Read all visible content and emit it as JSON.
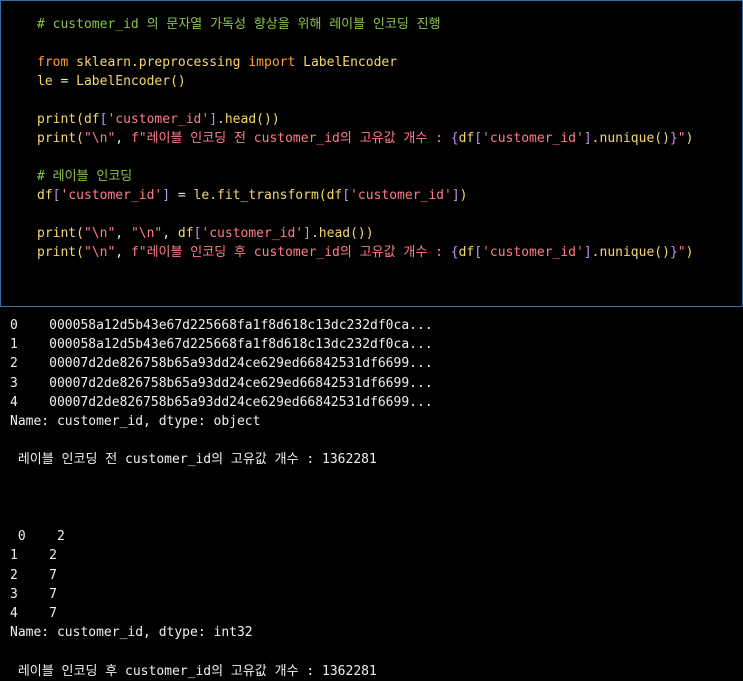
{
  "code_cell": {
    "lines": [
      {
        "tokens": [
          {
            "t": "# customer_id 의 문자열 가독성 향상을 위해 레이블 인코딩 진행",
            "c": "comment"
          }
        ]
      },
      {
        "tokens": []
      },
      {
        "tokens": [
          {
            "t": "from",
            "c": "keyword"
          },
          {
            "t": " ",
            "c": "punct"
          },
          {
            "t": "sklearn.preprocessing",
            "c": "module"
          },
          {
            "t": " ",
            "c": "punct"
          },
          {
            "t": "import",
            "c": "keyword"
          },
          {
            "t": " ",
            "c": "punct"
          },
          {
            "t": "LabelEncoder",
            "c": "class"
          }
        ]
      },
      {
        "tokens": [
          {
            "t": "le",
            "c": "var"
          },
          {
            "t": " = ",
            "c": "punct"
          },
          {
            "t": "LabelEncoder",
            "c": "class"
          },
          {
            "t": "()",
            "c": "bracket"
          }
        ]
      },
      {
        "tokens": []
      },
      {
        "tokens": [
          {
            "t": "print",
            "c": "func"
          },
          {
            "t": "(",
            "c": "bracket"
          },
          {
            "t": "df",
            "c": "var"
          },
          {
            "t": "[",
            "c": "brace"
          },
          {
            "t": "'customer_id'",
            "c": "string"
          },
          {
            "t": "]",
            "c": "brace"
          },
          {
            "t": ".head",
            "c": "func"
          },
          {
            "t": "())",
            "c": "bracket"
          }
        ]
      },
      {
        "tokens": [
          {
            "t": "print",
            "c": "func"
          },
          {
            "t": "(",
            "c": "bracket"
          },
          {
            "t": "\"\\n\"",
            "c": "string"
          },
          {
            "t": ", ",
            "c": "punct"
          },
          {
            "t": "f",
            "c": "fprefix"
          },
          {
            "t": "\"레이블 인코딩 전 customer_id의 고유값 개수 : ",
            "c": "string"
          },
          {
            "t": "{",
            "c": "brace"
          },
          {
            "t": "df",
            "c": "var"
          },
          {
            "t": "[",
            "c": "brace"
          },
          {
            "t": "'customer_id'",
            "c": "string"
          },
          {
            "t": "]",
            "c": "brace"
          },
          {
            "t": ".nunique",
            "c": "func"
          },
          {
            "t": "()",
            "c": "bracket"
          },
          {
            "t": "}",
            "c": "brace"
          },
          {
            "t": "\"",
            "c": "string"
          },
          {
            "t": ")",
            "c": "bracket"
          }
        ]
      },
      {
        "tokens": []
      },
      {
        "tokens": [
          {
            "t": "# 레이블 인코딩",
            "c": "comment"
          }
        ]
      },
      {
        "tokens": [
          {
            "t": "df",
            "c": "var"
          },
          {
            "t": "[",
            "c": "brace"
          },
          {
            "t": "'customer_id'",
            "c": "string"
          },
          {
            "t": "]",
            "c": "brace"
          },
          {
            "t": " = ",
            "c": "punct"
          },
          {
            "t": "le",
            "c": "var"
          },
          {
            "t": ".fit_transform",
            "c": "func"
          },
          {
            "t": "(",
            "c": "bracket"
          },
          {
            "t": "df",
            "c": "var"
          },
          {
            "t": "[",
            "c": "brace"
          },
          {
            "t": "'customer_id'",
            "c": "string"
          },
          {
            "t": "]",
            "c": "brace"
          },
          {
            "t": ")",
            "c": "bracket"
          }
        ]
      },
      {
        "tokens": []
      },
      {
        "tokens": [
          {
            "t": "print",
            "c": "func"
          },
          {
            "t": "(",
            "c": "bracket"
          },
          {
            "t": "\"\\n\"",
            "c": "string"
          },
          {
            "t": ", ",
            "c": "punct"
          },
          {
            "t": "\"\\n\"",
            "c": "string"
          },
          {
            "t": ", ",
            "c": "punct"
          },
          {
            "t": "df",
            "c": "var"
          },
          {
            "t": "[",
            "c": "brace"
          },
          {
            "t": "'customer_id'",
            "c": "string"
          },
          {
            "t": "]",
            "c": "brace"
          },
          {
            "t": ".head",
            "c": "func"
          },
          {
            "t": "())",
            "c": "bracket"
          }
        ]
      },
      {
        "tokens": [
          {
            "t": "print",
            "c": "func"
          },
          {
            "t": "(",
            "c": "bracket"
          },
          {
            "t": "\"\\n\"",
            "c": "string"
          },
          {
            "t": ", ",
            "c": "punct"
          },
          {
            "t": "f",
            "c": "fprefix"
          },
          {
            "t": "\"레이블 인코딩 후 customer_id의 고유값 개수 : ",
            "c": "string"
          },
          {
            "t": "{",
            "c": "brace"
          },
          {
            "t": "df",
            "c": "var"
          },
          {
            "t": "[",
            "c": "brace"
          },
          {
            "t": "'customer_id'",
            "c": "string"
          },
          {
            "t": "]",
            "c": "brace"
          },
          {
            "t": ".nunique",
            "c": "func"
          },
          {
            "t": "()",
            "c": "bracket"
          },
          {
            "t": "}",
            "c": "brace"
          },
          {
            "t": "\"",
            "c": "string"
          },
          {
            "t": ")",
            "c": "bracket"
          }
        ]
      }
    ]
  },
  "output": {
    "lines": [
      "0    000058a12d5b43e67d225668fa1f8d618c13dc232df0ca...",
      "1    000058a12d5b43e67d225668fa1f8d618c13dc232df0ca...",
      "2    00007d2de826758b65a93dd24ce629ed66842531df6699...",
      "3    00007d2de826758b65a93dd24ce629ed66842531df6699...",
      "4    00007d2de826758b65a93dd24ce629ed66842531df6699...",
      "Name: customer_id, dtype: object",
      "",
      " 레이블 인코딩 전 customer_id의 고유값 개수 : 1362281",
      "",
      "",
      "",
      " 0    2",
      "1    2",
      "2    7",
      "3    7",
      "4    7",
      "Name: customer_id, dtype: int32",
      "",
      " 레이블 인코딩 후 customer_id의 고유값 개수 : 1362281"
    ]
  },
  "colors": {
    "background": "#000000",
    "cell_border": "#3b6ea5",
    "comment": "#8bc34a",
    "keyword": "#ff9e3b",
    "identifier": "#f5d76e",
    "string": "#ff7b8a",
    "brace": "#c792ea",
    "output_text": "#f0f0f0"
  }
}
